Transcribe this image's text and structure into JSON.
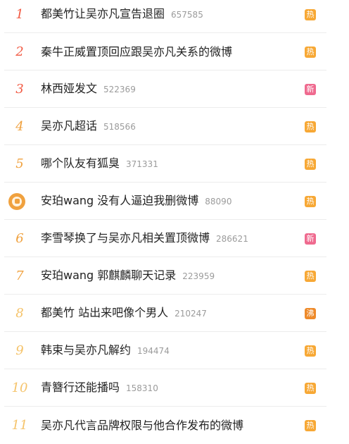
{
  "colors": {
    "rank_top": "#f25a43",
    "rank_mid": "#f0a13e",
    "rank_low": "#f5c36a",
    "badge_hot": "#f7a835",
    "badge_new": "#ef6a8f",
    "badge_boil": "#ee8a2a",
    "pin_icon": "#f0a13e"
  },
  "items": [
    {
      "rank": "1",
      "title": "都美竹让吴亦凡宣告退圈",
      "count": "657585",
      "badge": "热",
      "badge_type": "hot",
      "rank_color": "#f25a43"
    },
    {
      "rank": "2",
      "title": "秦牛正威置顶回应跟吴亦凡关系的微博",
      "count": "",
      "badge": "热",
      "badge_type": "hot",
      "rank_color": "#f25a43"
    },
    {
      "rank": "3",
      "title": "林西娅发文",
      "count": "522369",
      "badge": "新",
      "badge_type": "new",
      "rank_color": "#f25a43"
    },
    {
      "rank": "4",
      "title": "吴亦凡超话",
      "count": "518566",
      "badge": "热",
      "badge_type": "hot",
      "rank_color": "#f0a13e"
    },
    {
      "rank": "5",
      "title": "哪个队友有狐臭",
      "count": "371331",
      "badge": "热",
      "badge_type": "hot",
      "rank_color": "#f0a13e"
    },
    {
      "rank": "",
      "title": "安珀wang 没有人逼迫我删微博",
      "count": "88090",
      "badge": "热",
      "badge_type": "hot",
      "rank_color": "#f0a13e",
      "pinned": true,
      "icon": "promoted-pin-icon"
    },
    {
      "rank": "6",
      "title": "李雪琴换了与吴亦凡相关置顶微博",
      "count": "286621",
      "badge": "新",
      "badge_type": "new",
      "rank_color": "#f0a13e"
    },
    {
      "rank": "7",
      "title": "安珀wang 郭麒麟聊天记录",
      "count": "223959",
      "badge": "热",
      "badge_type": "hot",
      "rank_color": "#f0a13e"
    },
    {
      "rank": "8",
      "title": "都美竹 站出来吧像个男人",
      "count": "210247",
      "badge": "沸",
      "badge_type": "boil",
      "rank_color": "#f5c36a"
    },
    {
      "rank": "9",
      "title": "韩束与吴亦凡解约",
      "count": "194474",
      "badge": "热",
      "badge_type": "hot",
      "rank_color": "#f5c36a"
    },
    {
      "rank": "10",
      "title": "青簪行还能播吗",
      "count": "158310",
      "badge": "热",
      "badge_type": "hot",
      "rank_color": "#f5c36a"
    },
    {
      "rank": "11",
      "title": "吴亦凡代言品牌权限与他合作发布的微博",
      "count": "",
      "badge": "热",
      "badge_type": "hot",
      "rank_color": "#f5c36a"
    }
  ]
}
